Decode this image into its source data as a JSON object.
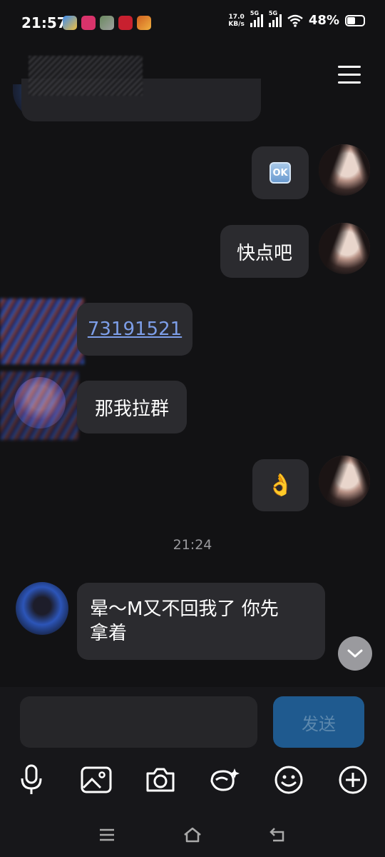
{
  "status_bar": {
    "time": "21:57",
    "net_speed_value": "17.0",
    "net_speed_unit": "KB/s",
    "sim1_tag": "5G",
    "sim2_tag": "5G",
    "battery": "48%"
  },
  "messages": [
    {
      "side": "right",
      "type": "emoji",
      "emoji_text": "OK"
    },
    {
      "side": "right",
      "type": "text",
      "text": "快点吧"
    },
    {
      "side": "left",
      "type": "link",
      "text": "73191521"
    },
    {
      "side": "left",
      "type": "text",
      "text": "那我拉群"
    },
    {
      "side": "right",
      "type": "emoji",
      "text": "👌"
    }
  ],
  "timestamp": "21:24",
  "last_message": {
    "line1": "晕～M又不回我了 你先",
    "line2": "拿着"
  },
  "composer": {
    "input_value": "",
    "send_label": "发送"
  },
  "toolbar_icons": [
    "microphone-icon",
    "image-icon",
    "camera-icon",
    "sticker-icon",
    "emoji-icon",
    "plus-icon"
  ],
  "colors": {
    "background": "#121214",
    "bubble": "#2b2b2f",
    "link": "#7d9ee8",
    "send_button": "#1f5a8f"
  }
}
